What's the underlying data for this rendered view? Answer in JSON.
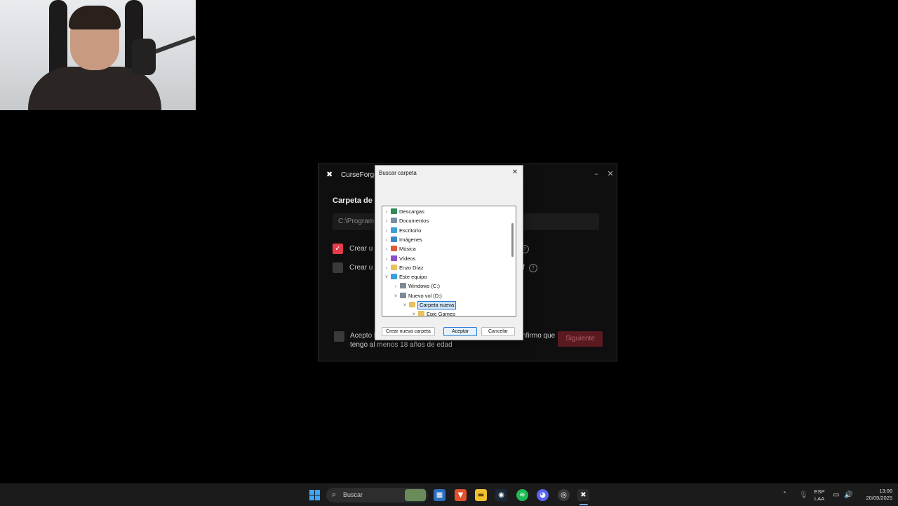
{
  "cf": {
    "title": "CurseForge",
    "section_label": "Carpeta de i",
    "path_value": "C:\\Program",
    "option1": "Crear u",
    "option2": "Crear u",
    "option2_tail": "f",
    "accept_line1_start": "Acepto l",
    "accept_line1_end": "nfirmo que",
    "accept_line2": "tengo al menos 18 años de edad",
    "next": "Siguiente",
    "minimize": "–",
    "close": "✕",
    "check_mark": "✓",
    "help": "?"
  },
  "dialog": {
    "title": "Buscar carpeta",
    "close": "✕",
    "tree": [
      {
        "label": "Descargas",
        "chev": "›",
        "color": "#2e8b57",
        "selected": false
      },
      {
        "label": "Documentos",
        "chev": "›",
        "color": "#7a8ea3",
        "selected": false
      },
      {
        "label": "Escritorio",
        "chev": "›",
        "color": "#3aa0d8",
        "selected": false
      },
      {
        "label": "Imágenes",
        "chev": "›",
        "color": "#3a86c8",
        "selected": false
      },
      {
        "label": "Música",
        "chev": "›",
        "color": "#e05a3a",
        "selected": false
      },
      {
        "label": "Vídeos",
        "chev": "›",
        "color": "#8a4fc8",
        "selected": false
      },
      {
        "label": "Enzo Díaz",
        "chev": "›",
        "color": "#e8c15a",
        "selected": false
      },
      {
        "label": "Este equipo",
        "chev": "˅",
        "color": "#3aa0d8",
        "selected": false
      },
      {
        "label": "Windows (C:)",
        "chev": "›",
        "color": "#7f8a96",
        "selected": false
      },
      {
        "label": "Nuevo vol (D:)",
        "chev": "˅",
        "color": "#7f8a96",
        "selected": false
      },
      {
        "label": "Carpeta nueva",
        "chev": "˅",
        "color": "#e8c15a",
        "selected": true
      },
      {
        "label": "Epic Games",
        "chev": "˅",
        "color": "#e8c15a",
        "selected": false
      }
    ],
    "btn_new_folder": "Crear nueva carpeta",
    "btn_ok": "Aceptar",
    "btn_cancel": "Cancelar"
  },
  "taskbar": {
    "search_placeholder": "Buscar",
    "lang_line1": "ESP",
    "lang_line2": "LAA",
    "time": "13:06",
    "date": "20/09/2025",
    "icons": [
      "windows-start-icon",
      "search-icon",
      "store-icon",
      "brave-icon",
      "file-explorer-icon",
      "steam-icon",
      "spotify-icon",
      "discord-icon",
      "chrome-icon",
      "curseforge-icon"
    ]
  },
  "colors": {
    "accent_red": "#e43c4a",
    "windows_blue": "#2a7bd4"
  }
}
